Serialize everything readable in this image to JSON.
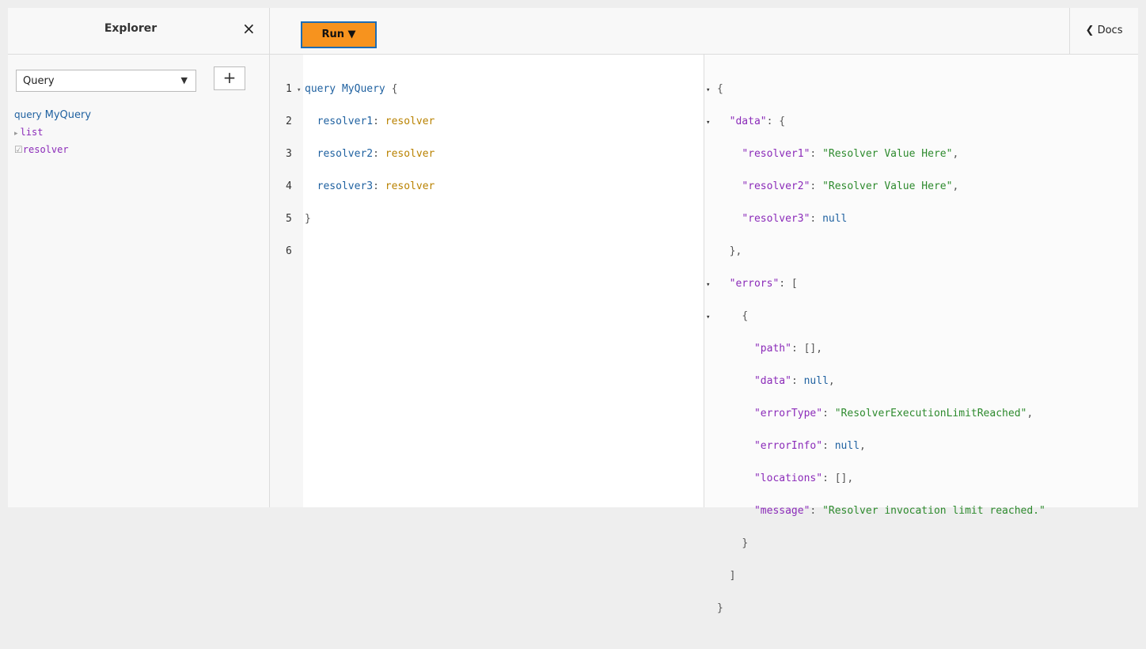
{
  "explorer": {
    "title": "Explorer",
    "close_icon": "×",
    "operation_select": "Query",
    "add_label": "+",
    "tree": {
      "keyword": "query",
      "name": "MyQuery",
      "items": [
        {
          "label": "list",
          "expander": "▸"
        },
        {
          "label": "resolver",
          "checkbox": "☑"
        }
      ]
    }
  },
  "toolbar": {
    "run_label": "Run ▼",
    "docs_label": "Docs"
  },
  "editor": {
    "lines": [
      {
        "num": "1",
        "kw": "query",
        "def": "MyQuery",
        "rest": " {"
      },
      {
        "num": "2",
        "prop": "resolver1",
        "field": "resolver"
      },
      {
        "num": "3",
        "prop": "resolver2",
        "field": "resolver"
      },
      {
        "num": "4",
        "prop": "resolver3",
        "field": "resolver"
      },
      {
        "num": "5",
        "text": "}"
      },
      {
        "num": "6",
        "text": ""
      }
    ]
  },
  "result": {
    "data": {
      "resolver1": "\"Resolver Value Here\"",
      "resolver2": "\"Resolver Value Here\"",
      "resolver3": "null"
    },
    "errors": {
      "path": "[]",
      "data": "null",
      "errorType": "\"ResolverExecutionLimitReached\"",
      "errorInfo": "null",
      "locations": "[]",
      "message": "\"Resolver invocation limit reached.\""
    }
  },
  "colors": {
    "run_button": "#f7931e",
    "keyword": "#1f61a0",
    "json_key": "#8b2bb9",
    "json_string": "#2d8a2d"
  }
}
